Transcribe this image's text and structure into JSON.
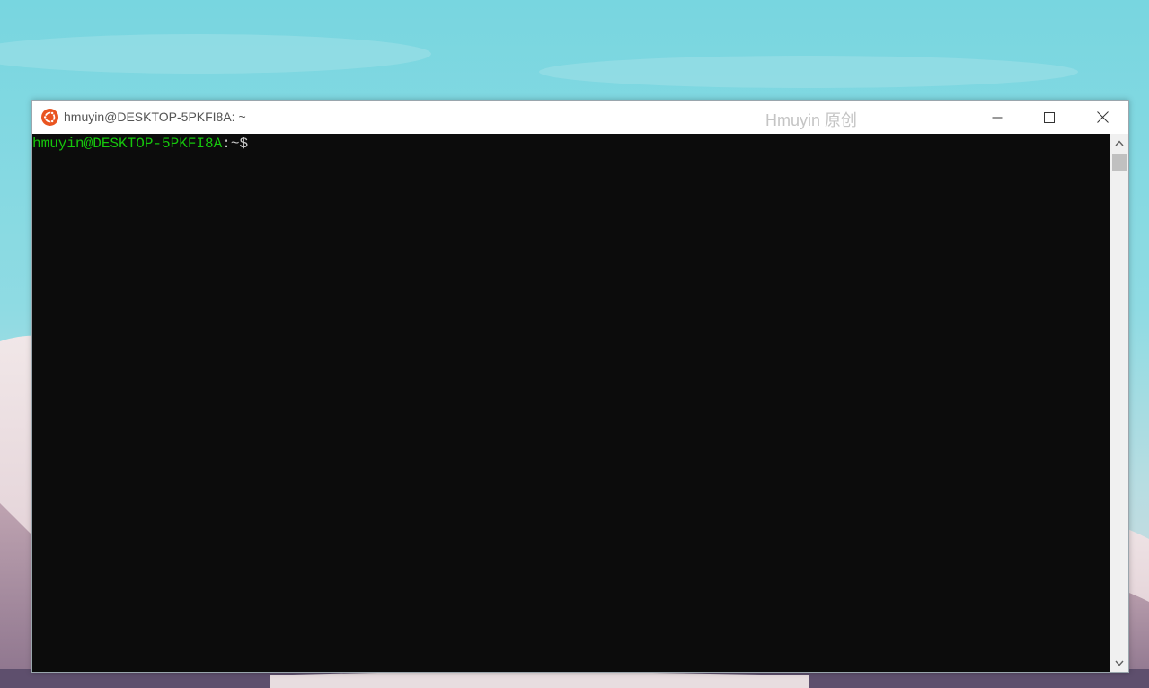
{
  "window": {
    "title": "hmuyin@DESKTOP-5PKFI8A: ~",
    "watermark": "Hmuyin 原创",
    "icon": "ubuntu-logo-icon",
    "accent_color": "#e95420"
  },
  "caption_buttons": {
    "minimize_icon": "minimize-icon",
    "maximize_icon": "maximize-icon",
    "close_icon": "close-icon"
  },
  "terminal": {
    "background": "#0c0c0c",
    "prompt": {
      "user_host": "hmuyin@DESKTOP-5PKFI8A",
      "separator": ":",
      "path": "~",
      "symbol": "$",
      "user_color": "#16c60c",
      "text_color": "#cccccc"
    }
  },
  "scrollbar": {
    "up_icon": "chevron-up-icon",
    "down_icon": "chevron-down-icon"
  }
}
